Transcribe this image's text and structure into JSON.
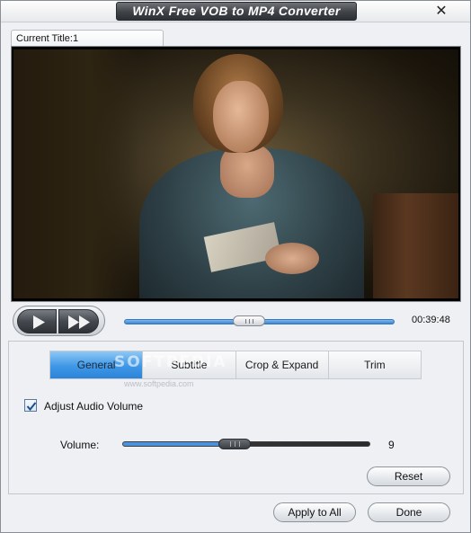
{
  "window": {
    "title": "WinX Free VOB to MP4 Converter",
    "close_symbol": "✕"
  },
  "preview": {
    "tab_label": "Current Title:1"
  },
  "player": {
    "play_icon": "play-icon",
    "fast_forward_icon": "fast-forward-icon",
    "seek_progress": 0.42,
    "time": "00:39:48"
  },
  "tabs": [
    {
      "label": "General",
      "active": true
    },
    {
      "label": "Subtitle",
      "active": false
    },
    {
      "label": "Crop & Expand",
      "active": false
    },
    {
      "label": "Trim",
      "active": false
    }
  ],
  "watermark": {
    "text": "SOFTPEDIA",
    "sub": "www.softpedia.com"
  },
  "general": {
    "adjust_audio_label": "Adjust Audio Volume",
    "adjust_audio_checked": true,
    "volume_label": "Volume:",
    "volume_value": "9",
    "volume_fraction": 0.5,
    "reset_label": "Reset"
  },
  "footer": {
    "apply_all_label": "Apply to All",
    "done_label": "Done"
  },
  "colors": {
    "accent": "#3f97e6",
    "title_plate": "#3f4247"
  }
}
